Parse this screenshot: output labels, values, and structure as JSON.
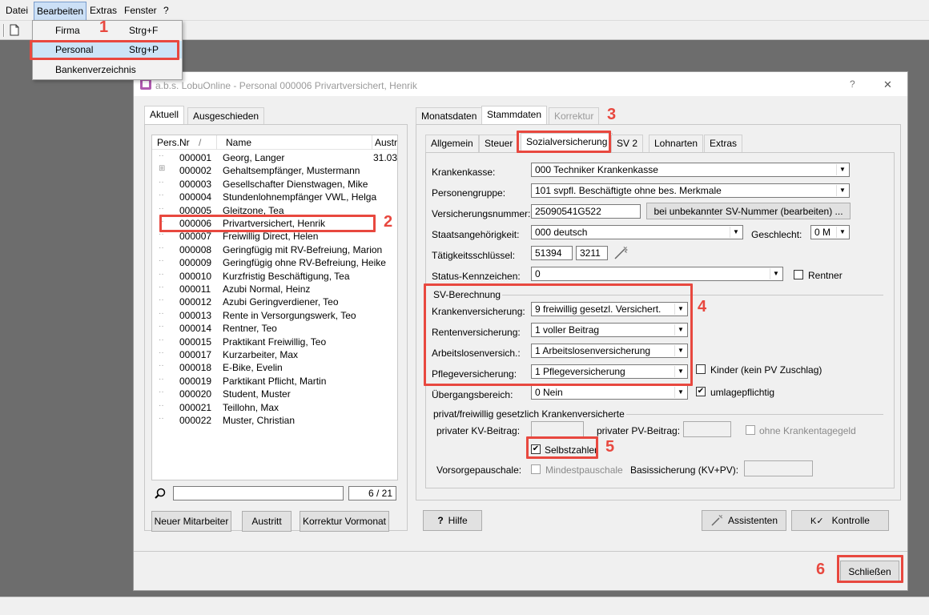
{
  "menubar": {
    "items": [
      "Datei",
      "Bearbeiten",
      "Extras",
      "Fenster",
      "?"
    ]
  },
  "dropdown": {
    "items": [
      {
        "label": "Firma",
        "shortcut": "Strg+F"
      },
      {
        "label": "Personal",
        "shortcut": "Strg+P"
      },
      {
        "label": "Bankenverzeichnis",
        "shortcut": ""
      }
    ]
  },
  "dialog": {
    "title": "a.b.s. LobuOnline - Personal 000006 Privartversichert, Henrik",
    "help_glyph": "?",
    "close_glyph": "✕",
    "left_tabs": [
      "Aktuell",
      "Ausgeschieden"
    ],
    "list_headers": {
      "persnr": "Pers.Nr",
      "sort": "/",
      "name": "Name",
      "austr": "Austr"
    },
    "employees": [
      {
        "persnr": "000001",
        "name": "Georg, Langer",
        "austr": "31.03",
        "tree": "··"
      },
      {
        "persnr": "000002",
        "name": "Gehaltsempfänger, Mustermann",
        "austr": "",
        "tree": "⊞"
      },
      {
        "persnr": "000003",
        "name": "Gesellschafter Dienstwagen, Mike",
        "austr": "",
        "tree": "··"
      },
      {
        "persnr": "000004",
        "name": "Stundenlohnempfänger VWL, Helga",
        "austr": "",
        "tree": "··"
      },
      {
        "persnr": "000005",
        "name": "Gleitzone, Tea",
        "austr": "",
        "tree": "··"
      },
      {
        "persnr": "000006",
        "name": "Privartversichert, Henrik",
        "austr": "",
        "tree": "··"
      },
      {
        "persnr": "000007",
        "name": "Freiwillig Direct, Helen",
        "austr": "",
        "tree": "··"
      },
      {
        "persnr": "000008",
        "name": "Geringfügig mit RV-Befreiung, Marion",
        "austr": "",
        "tree": "··"
      },
      {
        "persnr": "000009",
        "name": "Geringfügig ohne RV-Befreiung, Heike",
        "austr": "",
        "tree": "··"
      },
      {
        "persnr": "000010",
        "name": "Kurzfristig Beschäftigung, Tea",
        "austr": "",
        "tree": "··"
      },
      {
        "persnr": "000011",
        "name": "Azubi Normal, Heinz",
        "austr": "",
        "tree": "··"
      },
      {
        "persnr": "000012",
        "name": "Azubi Geringverdiener, Teo",
        "austr": "",
        "tree": "··"
      },
      {
        "persnr": "000013",
        "name": "Rente in Versorgungswerk, Teo",
        "austr": "",
        "tree": "··"
      },
      {
        "persnr": "000014",
        "name": "Rentner, Teo",
        "austr": "",
        "tree": "··"
      },
      {
        "persnr": "000015",
        "name": "Praktikant Freiwillig, Teo",
        "austr": "",
        "tree": "··"
      },
      {
        "persnr": "000017",
        "name": "Kurzarbeiter, Max",
        "austr": "",
        "tree": "··"
      },
      {
        "persnr": "000018",
        "name": "E-Bike, Evelin",
        "austr": "",
        "tree": "··"
      },
      {
        "persnr": "000019",
        "name": "Parktikant Pflicht, Martin",
        "austr": "",
        "tree": "··"
      },
      {
        "persnr": "000020",
        "name": "Student, Muster",
        "austr": "",
        "tree": "··"
      },
      {
        "persnr": "000021",
        "name": "Teillohn, Max",
        "austr": "",
        "tree": "··"
      },
      {
        "persnr": "000022",
        "name": "Muster, Christian",
        "austr": "",
        "tree": "··"
      }
    ],
    "search_count": "6 / 21",
    "left_buttons": {
      "new": "Neuer Mitarbeiter",
      "exit": "Austritt",
      "correction": "Korrektur Vormonat"
    },
    "top_tabs": [
      "Monatsdaten",
      "Stammdaten",
      "Korrektur"
    ],
    "sub_tabs": [
      "Allgemein",
      "Steuer",
      "Sozialversicherung",
      "SV 2",
      "Lohnarten",
      "Extras"
    ],
    "form": {
      "krankenkasse_label": "Krankenkasse:",
      "krankenkasse_value": "000 Techniker Krankenkasse",
      "personengruppe_label": "Personengruppe:",
      "personengruppe_value": "101 svpfl. Beschäftigte ohne bes. Merkmale",
      "versnr_label": "Versicherungsnummer:",
      "versnr_value": "25090541G522",
      "sv_unknown_button": "bei unbekannter SV-Nummer (bearbeiten) ...",
      "staat_label": "Staatsangehörigkeit:",
      "staat_value": "000 deutsch",
      "geschlecht_label": "Geschlecht:",
      "geschlecht_value": "0 M",
      "taetig_label": "Tätigkeitsschlüssel:",
      "taetig_value1": "51394",
      "taetig_value2": "3211",
      "status_label": "Status-Kennzeichen:",
      "status_value": "0",
      "rentner_label": "Rentner",
      "sv_group_title": "SV-Berechnung",
      "kv_label": "Krankenversicherung:",
      "kv_value": "9 freiwillig gesetzl. Versichert.",
      "rv_label": "Rentenversicherung:",
      "rv_value": "1 voller Beitrag",
      "av_label": "Arbeitslosenversich.:",
      "av_value": "1 Arbeitslosenversicherung",
      "pv_label": "Pflegeversicherung:",
      "pv_value": "1 Pflegeversicherung",
      "kinder_label": "Kinder (kein PV Zuschlag)",
      "uebergang_label": "Übergangsbereich:",
      "uebergang_value": "0 Nein",
      "umlage_label": "umlagepflichtig",
      "privat_group_title": "privat/freiwillig gesetzlich Krankenversicherte",
      "priv_kv_label": "privater KV-Beitrag:",
      "priv_pv_label": "privater PV-Beitrag:",
      "ohne_kt_label": "ohne Krankentagegeld",
      "selbstzahler_label": "Selbstzahler",
      "vorsorge_label": "Vorsorgepauschale:",
      "mindest_label": "Mindestpauschale",
      "basis_label": "Basissicherung (KV+PV):"
    },
    "bottom_buttons": {
      "help": "Hilfe",
      "assist": "Assistenten",
      "control": "Kontrolle"
    },
    "close_button": "Schließen"
  },
  "callouts": [
    "1",
    "2",
    "3",
    "4",
    "5",
    "6"
  ],
  "colors": {
    "highlight": "#e8483f",
    "background": "#6d6d6d",
    "dialog": "#f0f0f0"
  }
}
